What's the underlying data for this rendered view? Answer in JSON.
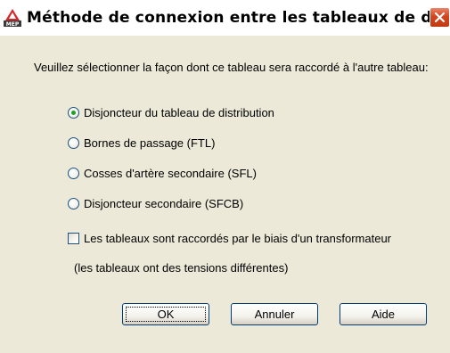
{
  "window": {
    "title": "Méthode de connexion entre les tableaux de dist...",
    "icon_label": "MEP"
  },
  "prompt": "Veuillez sélectionner la façon dont ce tableau sera raccordé à l'autre tableau:",
  "options": [
    {
      "label": "Disjoncteur du tableau de distribution",
      "selected": true
    },
    {
      "label": "Bornes de passage (FTL)",
      "selected": false
    },
    {
      "label": "Cosses d'artère secondaire (SFL)",
      "selected": false
    },
    {
      "label": "Disjoncteur secondaire (SFCB)",
      "selected": false
    }
  ],
  "transformer_checkbox": {
    "label": "Les tableaux sont raccordés par le biais d'un transformateur",
    "checked": false
  },
  "transformer_note": "(les tableaux ont des tensions différentes)",
  "buttons": {
    "ok": "OK",
    "cancel": "Annuler",
    "help": "Aide"
  },
  "colors": {
    "dialog_face": "#ece9d8",
    "radio_selected": "#21a121",
    "close_button": "#d2461f"
  }
}
